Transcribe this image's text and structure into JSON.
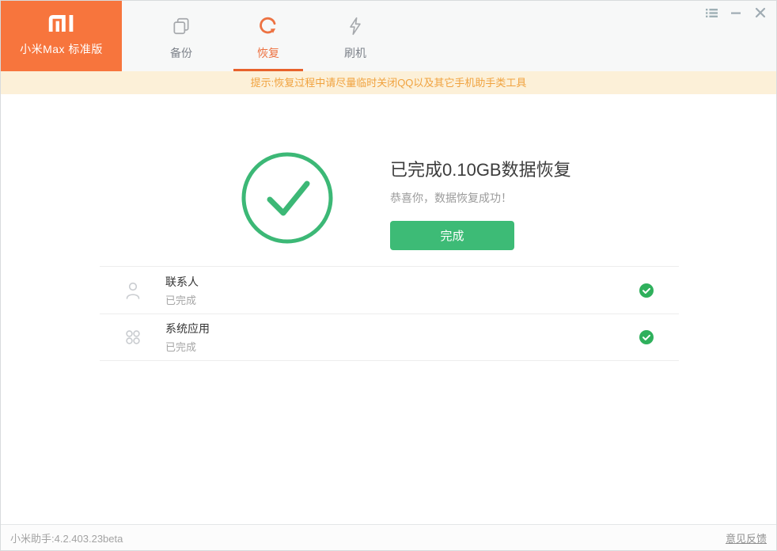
{
  "window": {
    "device_name": "小米Max 标准版",
    "controls": {
      "menu": "task-list",
      "minimize": "minimize",
      "close": "close"
    }
  },
  "tabs": [
    {
      "label": "备份",
      "icon": "backup-copy-icon",
      "active": false
    },
    {
      "label": "恢复",
      "icon": "restore-icon",
      "active": true
    },
    {
      "label": "刷机",
      "icon": "flash-lightning-icon",
      "active": false
    }
  ],
  "notice": {
    "text": "提示:恢复过程中请尽量临时关闭QQ以及其它手机助手类工具"
  },
  "result": {
    "title": "已完成0.10GB数据恢复",
    "subtitle": "恭喜你，数据恢复成功！",
    "button_label": "完成",
    "status_icon": "success-check-circle"
  },
  "items": [
    {
      "name": "联系人",
      "status": "已完成",
      "icon": "contact-person-icon",
      "badge": "check-badge"
    },
    {
      "name": "系统应用",
      "status": "已完成",
      "icon": "apps-grid-icon",
      "badge": "check-badge"
    }
  ],
  "footer": {
    "version": "小米助手:4.2.403.23beta",
    "feedback_label": "意见反馈"
  },
  "colors": {
    "brand_orange": "#f7753d",
    "accent_orange": "#ed7242",
    "tab_underline": "#e8622c",
    "notice_bg": "#fcf0d8",
    "notice_text": "#f0a23e",
    "success_green": "#3cb876",
    "button_green": "#3dbb76",
    "badge_green": "#2fb05c"
  }
}
